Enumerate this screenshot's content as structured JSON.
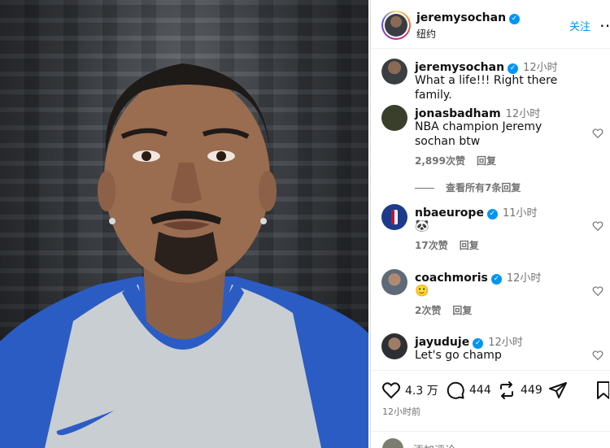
{
  "post": {
    "username": "jeremysochan",
    "location": "纽约",
    "follow_label": "关注",
    "more_icon": "more-icon"
  },
  "caption": {
    "username": "jeremysochan",
    "time": "12小时",
    "text": "What a life!!! Right there family."
  },
  "comments": [
    {
      "username": "jonasbadham",
      "verified": false,
      "time": "12小时",
      "text": "NBA champion Jeremy sochan btw",
      "likes": "2,899次赞",
      "reply": "回复"
    },
    {
      "username": "nbaeurope",
      "verified": true,
      "time": "11小时",
      "text": "🐼",
      "likes": "17次赞",
      "reply": "回复"
    },
    {
      "username": "coachmoris",
      "verified": true,
      "time": "12小时",
      "text": "🙂",
      "likes": "2次赞",
      "reply": "回复"
    },
    {
      "username": "jayuduje",
      "verified": true,
      "time": "12小时",
      "text": "Let's go champ",
      "likes": "",
      "reply": ""
    }
  ],
  "view_replies": "查看所有7条回复",
  "actions": {
    "likes": "4.3 万",
    "comments": "444",
    "reposts": "449"
  },
  "post_time": "12小时前",
  "add_comment_placeholder": "添加评论...",
  "colors": {
    "accent": "#0095f6",
    "muted": "#737373",
    "jersey_blue": "#2b5cc4"
  }
}
